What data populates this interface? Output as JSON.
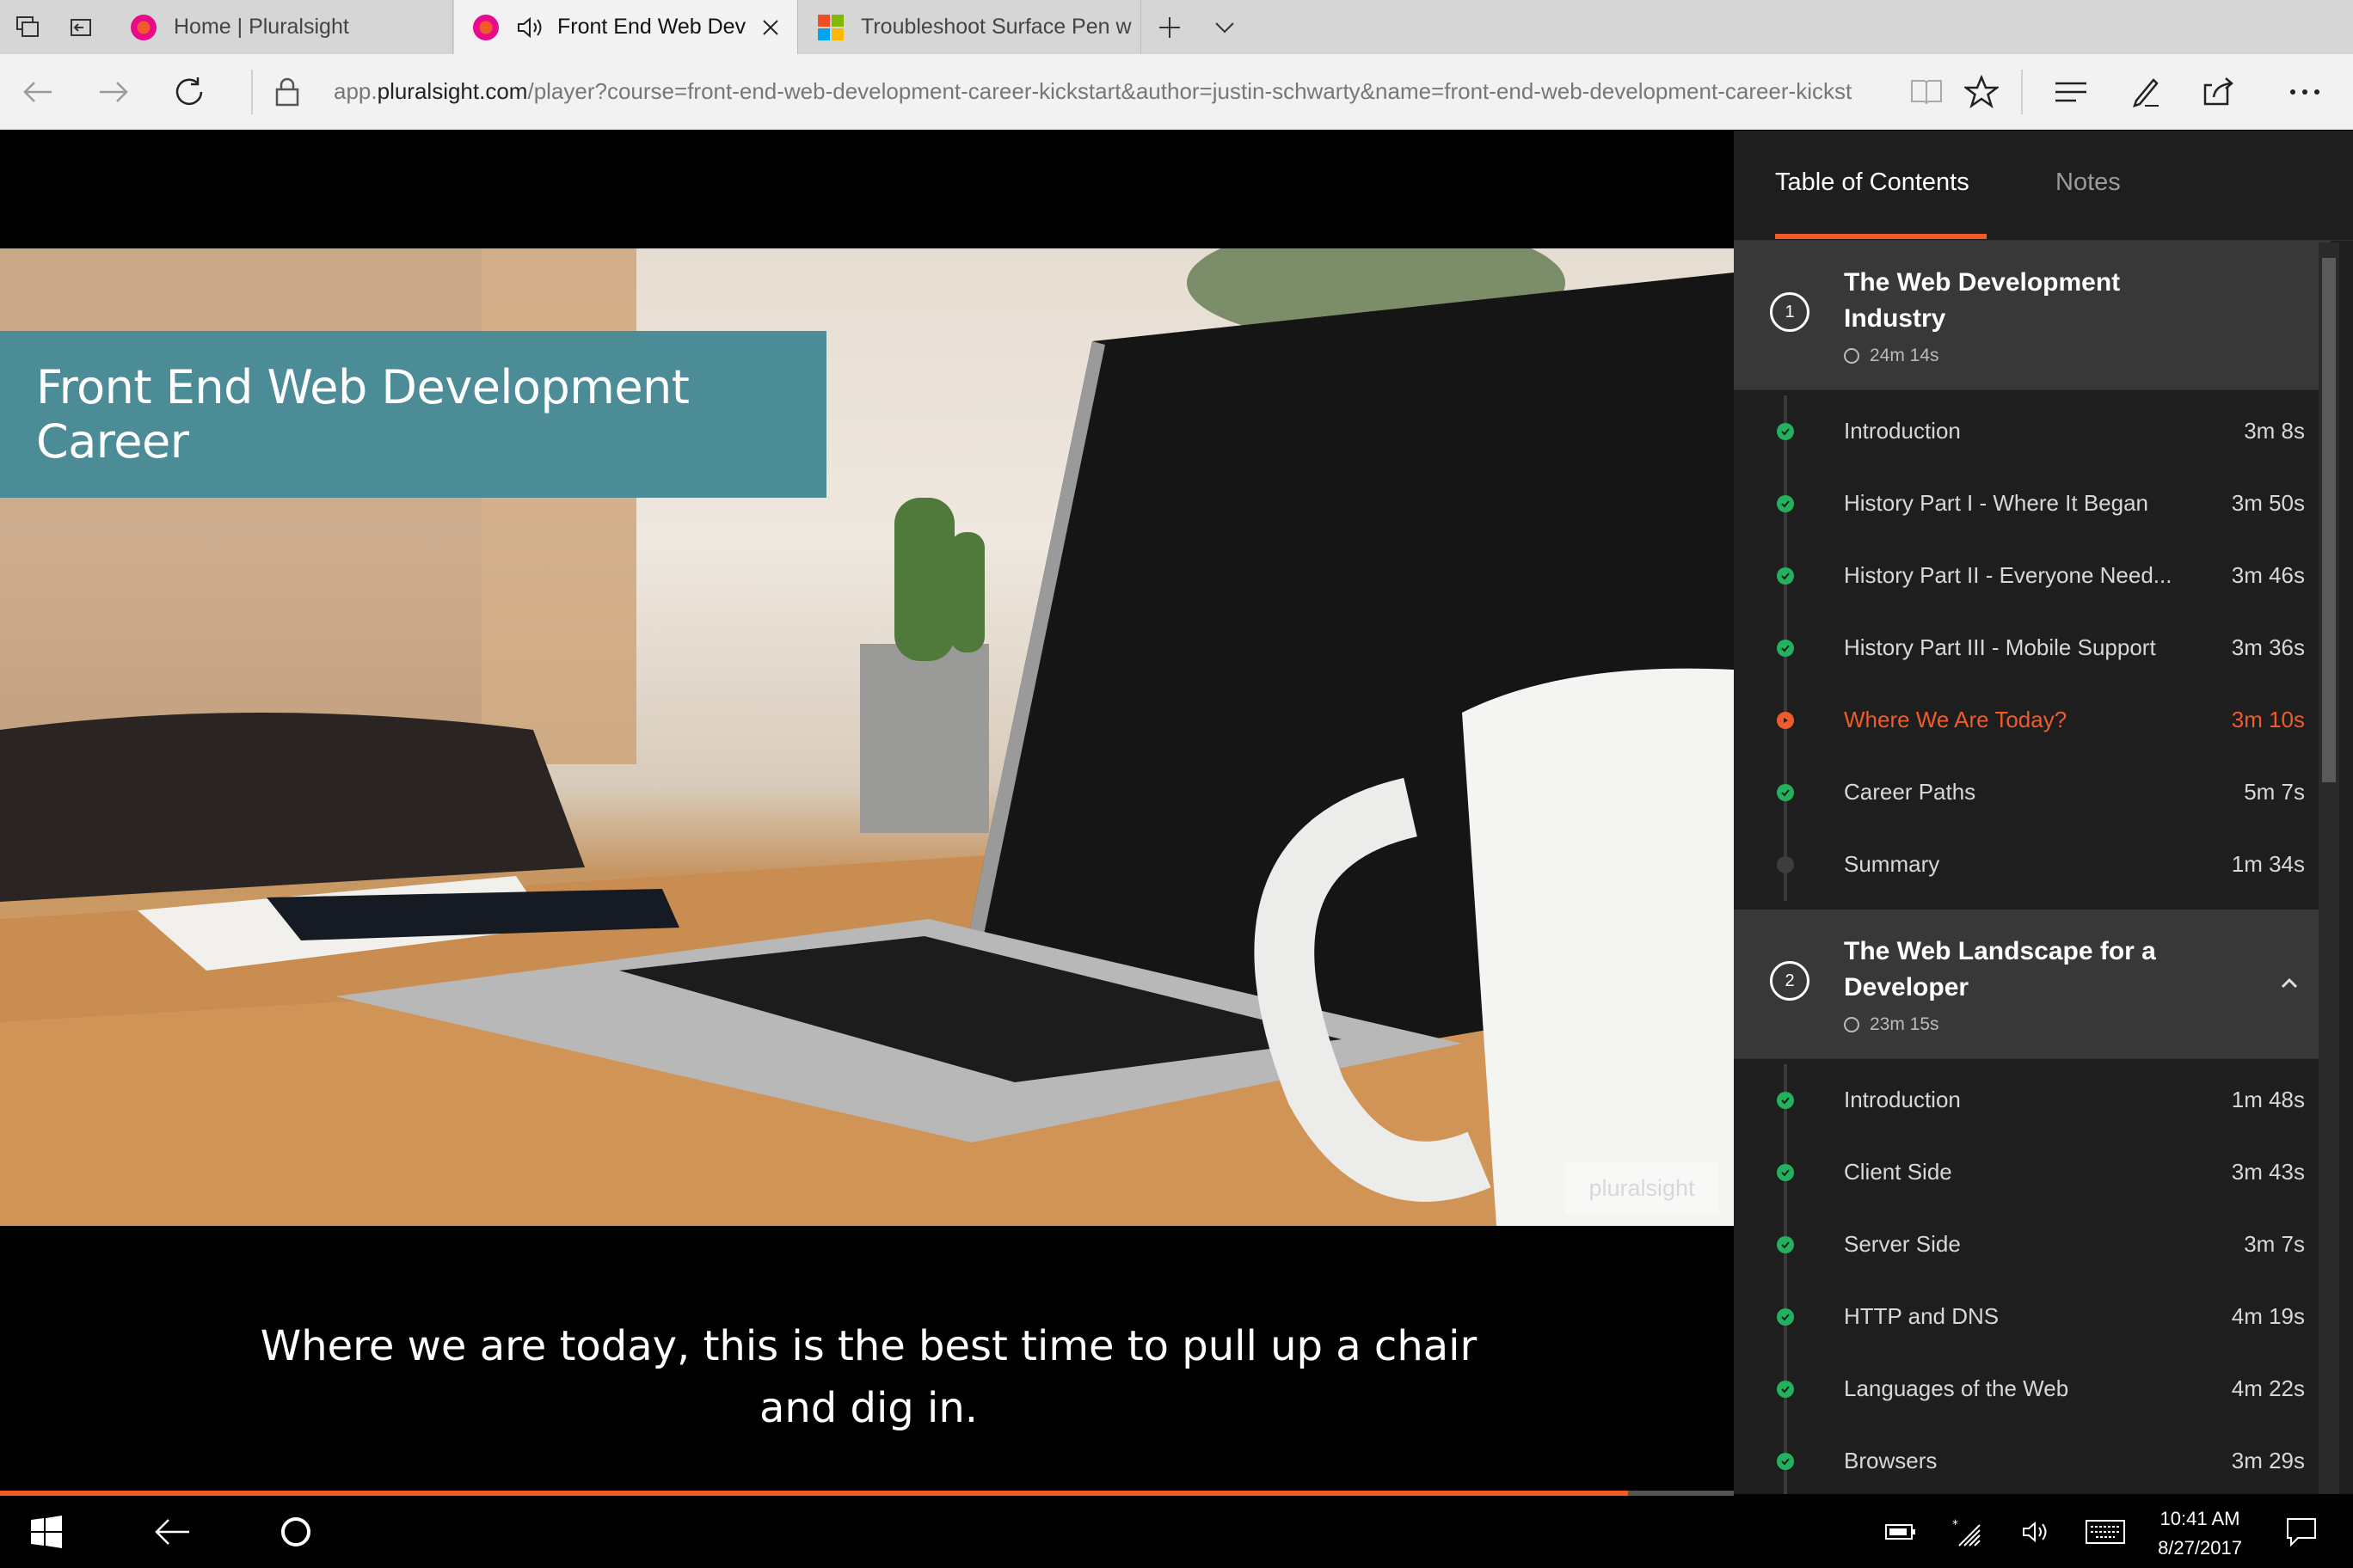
{
  "browser": {
    "tabs": [
      {
        "title": "Home | Pluralsight",
        "favicon": "pluralsight-icon",
        "active": false
      },
      {
        "title": "Front End Web Dev",
        "favicon": "pluralsight-icon",
        "active": true,
        "audio": true
      },
      {
        "title": "Troubleshoot Surface Pen w",
        "favicon": "microsoft-icon",
        "active": false
      }
    ],
    "url": {
      "prefix": "app.",
      "domain": "pluralsight.com",
      "path": "/player?course=front-end-web-development-career-kickstart&author=justin-schwarty&name=front-end-web-development-career-kickst"
    }
  },
  "video": {
    "title_banner": "Front End Web Development Career",
    "watermark": "pluralsight",
    "caption_line1": "Where we are today, this is the best time to pull up a chair",
    "caption_line2": "and dig in.",
    "progress_fraction": 0.939,
    "accent_color": "#f15b2a"
  },
  "panel": {
    "tabs": [
      "Table of Contents",
      "Notes"
    ],
    "active_tab": 0,
    "modules": [
      {
        "number": "1",
        "title_line1": "The Web Development",
        "title_line2": "Industry",
        "duration": "24m 14s",
        "clips": [
          {
            "title": "Introduction",
            "duration": "3m 8s",
            "status": "done"
          },
          {
            "title": "History Part I - Where It Began",
            "duration": "3m 50s",
            "status": "done"
          },
          {
            "title": "History Part II - Everyone Need...",
            "duration": "3m 46s",
            "status": "done"
          },
          {
            "title": "History Part III - Mobile Support",
            "duration": "3m 36s",
            "status": "done"
          },
          {
            "title": "Where We Are Today?",
            "duration": "3m 10s",
            "status": "current"
          },
          {
            "title": "Career Paths",
            "duration": "5m 7s",
            "status": "done"
          },
          {
            "title": "Summary",
            "duration": "1m 34s",
            "status": "todo"
          }
        ]
      },
      {
        "number": "2",
        "title_line1": "The Web Landscape for a",
        "title_line2": "Developer",
        "duration": "23m 15s",
        "clips": [
          {
            "title": "Introduction",
            "duration": "1m 48s",
            "status": "done"
          },
          {
            "title": "Client Side",
            "duration": "3m 43s",
            "status": "done"
          },
          {
            "title": "Server Side",
            "duration": "3m 7s",
            "status": "done"
          },
          {
            "title": "HTTP and DNS",
            "duration": "4m 19s",
            "status": "done"
          },
          {
            "title": "Languages of the Web",
            "duration": "4m 22s",
            "status": "done"
          },
          {
            "title": "Browsers",
            "duration": "3m 29s",
            "status": "done"
          }
        ]
      }
    ]
  },
  "taskbar": {
    "time": "10:41 AM",
    "date": "8/27/2017"
  }
}
